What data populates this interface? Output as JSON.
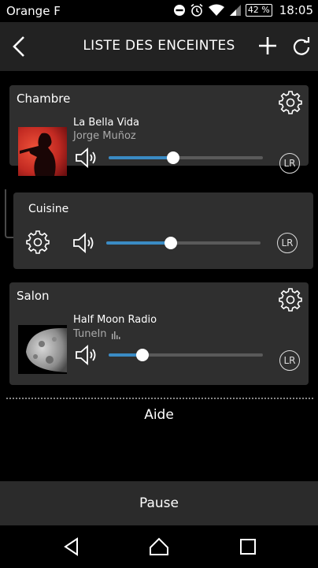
{
  "status_bar": {
    "carrier": "Orange F",
    "battery": "42 %",
    "time": "18:05"
  },
  "header": {
    "title": "LISTE DES ENCEINTES",
    "icons": [
      "back-arrow-icon",
      "plus-icon",
      "refresh-icon"
    ]
  },
  "speakers": [
    {
      "name": "Chambre",
      "track": "La Bella Vida",
      "artist": "Jorge Muñoz",
      "volume_percent": 42,
      "channel": "LR"
    },
    {
      "name": "Cuisine",
      "volume_percent": 42,
      "channel": "LR"
    },
    {
      "name": "Salon",
      "track": "Half Moon Radio",
      "source": "TuneIn",
      "volume_percent": 22,
      "channel": "LR"
    }
  ],
  "help_link": "Aide",
  "pause_button": "Pause",
  "colors": {
    "accent": "#3a8bc4",
    "card_bg": "#2f2f2f",
    "title_bar_bg": "#222222"
  }
}
